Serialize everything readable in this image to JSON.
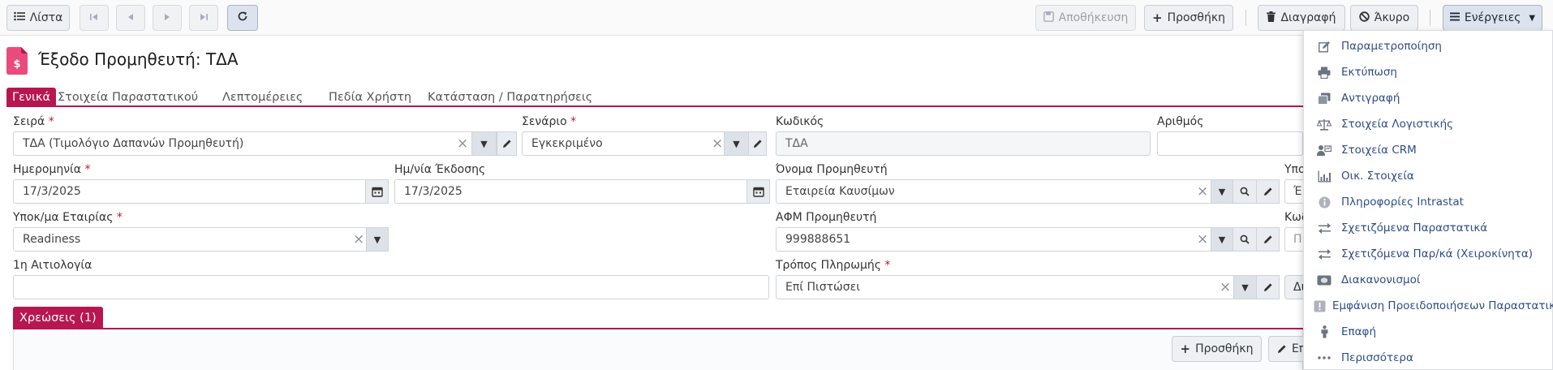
{
  "toolbar": {
    "list": "Λίστα",
    "save": "Αποθήκευση",
    "add": "Προσθήκη",
    "delete": "Διαγραφή",
    "cancel": "Άκυρο",
    "actions": "Ενέργειες"
  },
  "title": "Έξοδο Προμηθευτή: ΤΔΑ",
  "tabs": [
    "Γενικά",
    "Στοιχεία Παραστατικού",
    "Λεπτομέρειες",
    "Πεδία Χρήστη",
    "Κατάσταση / Παρατηρήσεις"
  ],
  "form": {
    "series": {
      "label": "Σειρά",
      "value": "ΤΔΑ (Τιμολόγιο Δαπανών Προμηθευτή)"
    },
    "scenario": {
      "label": "Σενάριο",
      "value": "Εγκεκριμένο"
    },
    "code": {
      "label": "Κωδικός",
      "value": "ΤΔΑ"
    },
    "number": {
      "label": "Αριθμός",
      "value": ""
    },
    "date": {
      "label": "Ημερομηνία",
      "value": "17/3/2025"
    },
    "issue_date": {
      "label": "Ημ/νία Έκδοσης",
      "value": "17/3/2025"
    },
    "supplier_name": {
      "label": "Όνομα Προμηθευτή",
      "value": "Εταιρεία Καυσίμων"
    },
    "cut_label_1": "Υπο",
    "cut_value_1": "Έ",
    "company_branch": {
      "label": "Υποκ/μα Εταιρίας",
      "value": "Readiness"
    },
    "supplier_vat": {
      "label": "ΑΦΜ Προμηθευτή",
      "value": "999888651"
    },
    "cut_label_2": "Κωδ",
    "cut_value_2": "Π",
    "reason": {
      "label": "1η Αιτιολογία",
      "value": ""
    },
    "payment": {
      "label": "Τρόπος Πληρωμής",
      "value": "Επί Πιστώσει"
    },
    "cut_button": "Δι"
  },
  "charges": {
    "tab": "Χρεώσεις (1)",
    "add": "Προσθήκη",
    "edit_cut": "Επ"
  },
  "menu": [
    {
      "label": "Παραμετροποίηση",
      "icon": "edit-icon"
    },
    {
      "label": "Εκτύπωση",
      "icon": "print-icon"
    },
    {
      "label": "Αντιγραφή",
      "icon": "copy-icon"
    },
    {
      "label": "Στοιχεία Λογιστικής",
      "icon": "scales-icon"
    },
    {
      "label": "Στοιχεία CRM",
      "icon": "contact-card-icon"
    },
    {
      "label": "Οικ. Στοιχεία",
      "icon": "chart-icon"
    },
    {
      "label": "Πληροφορίες Intrastat",
      "icon": "info-icon"
    },
    {
      "label": "Σχετιζόμενα Παραστατικά",
      "icon": "exchange-icon"
    },
    {
      "label": "Σχετιζόμενα Παρ/κά (Χειροκίνητα)",
      "icon": "exchange-icon"
    },
    {
      "label": "Διακανονισμοί",
      "icon": "money-icon"
    },
    {
      "label": "Εμφάνιση Προειδοποιήσεων Παραστατικού",
      "icon": "warning-icon"
    },
    {
      "label": "Επαφή",
      "icon": "person-icon"
    },
    {
      "label": "Περισσότερα",
      "icon": "more-icon"
    }
  ],
  "colors": {
    "accent": "#b8164f",
    "link": "#2f4d86"
  }
}
